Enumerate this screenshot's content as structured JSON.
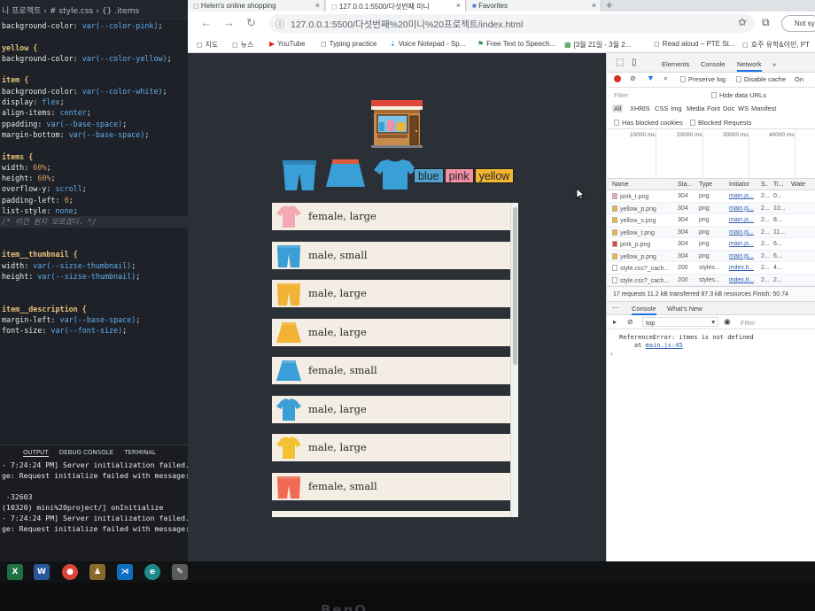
{
  "vscode": {
    "tabbar": [
      "니 프로젝트",
      "›",
      "#",
      "style.css",
      "›",
      "{}",
      ".items"
    ],
    "code_lines": [
      [
        {
          "t": "background-color: ",
          "c": "prop"
        },
        {
          "t": "var(--color-pink)",
          "c": "val"
        },
        {
          "t": ";",
          "c": "prop"
        }
      ],
      [],
      [
        {
          "t": "yellow {",
          "c": "sel"
        }
      ],
      [
        {
          "t": "background-color: ",
          "c": "prop"
        },
        {
          "t": "var(--color-yellow)",
          "c": "val"
        },
        {
          "t": ";",
          "c": "prop"
        }
      ],
      [],
      [
        {
          "t": "item {",
          "c": "sel"
        }
      ],
      [
        {
          "t": "background-color: ",
          "c": "prop"
        },
        {
          "t": "var(--color-white)",
          "c": "val"
        },
        {
          "t": ";",
          "c": "prop"
        }
      ],
      [
        {
          "t": "display: ",
          "c": "prop"
        },
        {
          "t": "flex",
          "c": "val"
        },
        {
          "t": ";",
          "c": "prop"
        }
      ],
      [
        {
          "t": "align-items: ",
          "c": "prop"
        },
        {
          "t": "center",
          "c": "val"
        },
        {
          "t": ";",
          "c": "prop"
        }
      ],
      [
        {
          "t": "ppadding: ",
          "c": "prop"
        },
        {
          "t": "var(--base-space)",
          "c": "val"
        },
        {
          "t": ";",
          "c": "prop"
        }
      ],
      [
        {
          "t": "margin-bottom: ",
          "c": "prop"
        },
        {
          "t": "var(--base-space)",
          "c": "val"
        },
        {
          "t": ";",
          "c": "prop"
        }
      ],
      [],
      [
        {
          "t": "items {",
          "c": "sel"
        }
      ],
      [
        {
          "t": "width: ",
          "c": "prop"
        },
        {
          "t": "60%",
          "c": "num"
        },
        {
          "t": ";",
          "c": "prop"
        }
      ],
      [
        {
          "t": "height: ",
          "c": "prop"
        },
        {
          "t": "60%",
          "c": "num"
        },
        {
          "t": ";",
          "c": "prop"
        }
      ],
      [
        {
          "t": "overflow-y: ",
          "c": "prop"
        },
        {
          "t": "scroll",
          "c": "val"
        },
        {
          "t": ";",
          "c": "prop"
        }
      ],
      [
        {
          "t": "padding-left: ",
          "c": "prop"
        },
        {
          "t": "0",
          "c": "num"
        },
        {
          "t": ";",
          "c": "prop"
        }
      ],
      [
        {
          "t": "list-style: ",
          "c": "prop"
        },
        {
          "t": "none",
          "c": "val"
        },
        {
          "t": ";",
          "c": "prop"
        }
      ],
      [
        {
          "t": "/* 이건 뭔지 모르겠다. */",
          "c": "cmt"
        }
      ],
      [],
      [],
      [
        {
          "t": "item__thumbnail {",
          "c": "sel"
        }
      ],
      [
        {
          "t": "width: ",
          "c": "prop"
        },
        {
          "t": "var(--sizse-thumbnail)",
          "c": "val"
        },
        {
          "t": ";",
          "c": "prop"
        }
      ],
      [
        {
          "t": "height: ",
          "c": "prop"
        },
        {
          "t": "var(--sizse-thumbnail)",
          "c": "val"
        },
        {
          "t": ";",
          "c": "prop"
        }
      ],
      [],
      [],
      [
        {
          "t": "item__description {",
          "c": "sel"
        }
      ],
      [
        {
          "t": "margin-left: ",
          "c": "prop"
        },
        {
          "t": "var(--base-space)",
          "c": "val"
        },
        {
          "t": ";",
          "c": "prop"
        }
      ],
      [
        {
          "t": "font-size: ",
          "c": "prop"
        },
        {
          "t": "var(--font-size)",
          "c": "val"
        },
        {
          "t": ";",
          "c": "prop"
        }
      ]
    ],
    "panel_tabs": [
      "OUTPUT",
      "DEBUG CONSOLE",
      "TERMINAL"
    ],
    "terminal_lines": [
      "- 7:24:24 PM] Server initialization failed.",
      "ge: Request initialize failed with message:",
      "",
      " -32603",
      "(10320) mini%20project/] onInitialize",
      "- 7:24:24 PM] Server initialization failed.",
      "ge: Request initialize failed with message:"
    ]
  },
  "browser": {
    "tabs": [
      {
        "title": "Helen's online shopping"
      },
      {
        "title": "127.0.0.1:5500/다섯번째 미니"
      },
      {
        "title": "Favorites"
      }
    ],
    "new_tab_label": "+",
    "url": "127.0.0.1:5500/다섯번째%20미니%20프로젝트/index.html",
    "profile_label": "Not syn",
    "bookmarks": [
      "지도",
      "뉴스",
      "YouTube",
      "Typing practice",
      "Voice Notepad - Sp...",
      "Free Text to Speech...",
      "[3월 21일 - 3월 2...",
      "Read aloud – PTE St...",
      "호주 유학&이민, PT"
    ]
  },
  "page": {
    "color_buttons": [
      "blue",
      "pink",
      "yellow"
    ],
    "items": [
      {
        "desc": "female, large",
        "kind": "tshirt",
        "color": "#f3a9b4"
      },
      {
        "desc": "male, small",
        "kind": "pants",
        "color": "#3a9fd6"
      },
      {
        "desc": "male, large",
        "kind": "pants",
        "color": "#f2b233"
      },
      {
        "desc": "male, large",
        "kind": "skirt",
        "color": "#f2b233"
      },
      {
        "desc": "female, small",
        "kind": "skirt",
        "color": "#3a9fd6"
      },
      {
        "desc": "male, large",
        "kind": "tshirt",
        "color": "#3a9fd6"
      },
      {
        "desc": "male, large",
        "kind": "tshirt",
        "color": "#f2c231"
      },
      {
        "desc": "female, small",
        "kind": "pants",
        "color": "#f06b55"
      }
    ],
    "swatch_colors": {
      "blue": "#3a9fd6",
      "pink": "#f38fa4",
      "yellow": "#f1b52f"
    }
  },
  "devtools": {
    "tabs": [
      "Elements",
      "Console",
      "Network",
      "»"
    ],
    "toolbar": {
      "preserve_log": "Preserve log",
      "disable_cache": "Disable cache",
      "online": "On"
    },
    "filter_placeholder": "Filter",
    "hide_data_urls": "Hide data URLs",
    "types": [
      "All",
      "XHR",
      "JS",
      "CSS",
      "Img",
      "Media",
      "Font",
      "Doc",
      "WS",
      "Manifest"
    ],
    "has_blocked_cookies": "Has blocked cookies",
    "blocked_requests": "Blocked Requests",
    "timeline_ticks": [
      "10000 ms",
      "20000 ms",
      "30000 ms",
      "40000 ms"
    ],
    "columns": [
      "Name",
      "Sta...",
      "Type",
      "Initiator",
      "S..",
      "Ti...",
      "Wate"
    ],
    "rows": [
      [
        "pink_t.png",
        "304",
        "png",
        "main.js...",
        "2...",
        "0..."
      ],
      [
        "yellow_p.png",
        "304",
        "png",
        "main.js...",
        "2...",
        "10..."
      ],
      [
        "yellow_s.png",
        "304",
        "png",
        "main.js...",
        "2...",
        "8..."
      ],
      [
        "yellow_t.png",
        "304",
        "png",
        "main.js...",
        "2...",
        "11..."
      ],
      [
        "pink_p.png",
        "304",
        "png",
        "main.js...",
        "2...",
        "6..."
      ],
      [
        "yellow_p.png",
        "304",
        "png",
        "main.js...",
        "2...",
        "6..."
      ],
      [
        "style.css?_cach...",
        "200",
        "styles...",
        "index.h...",
        "2...",
        "4..."
      ],
      [
        "style.css?_cach...",
        "200",
        "styles...",
        "index.h...",
        "2...",
        "2..."
      ]
    ],
    "summary": "17 requests   11.2 kB transferred   87.3 kB resources   Finish: 50.74",
    "drawer_tabs": [
      "Console",
      "What's New"
    ],
    "console_context": "top",
    "console_filter": "Filter",
    "error_text": "ReferenceError: itmes is not defined",
    "error_at": "    at ",
    "error_link": "main.js:45",
    "prompt": "›"
  },
  "monitor_brand": "BenQ"
}
